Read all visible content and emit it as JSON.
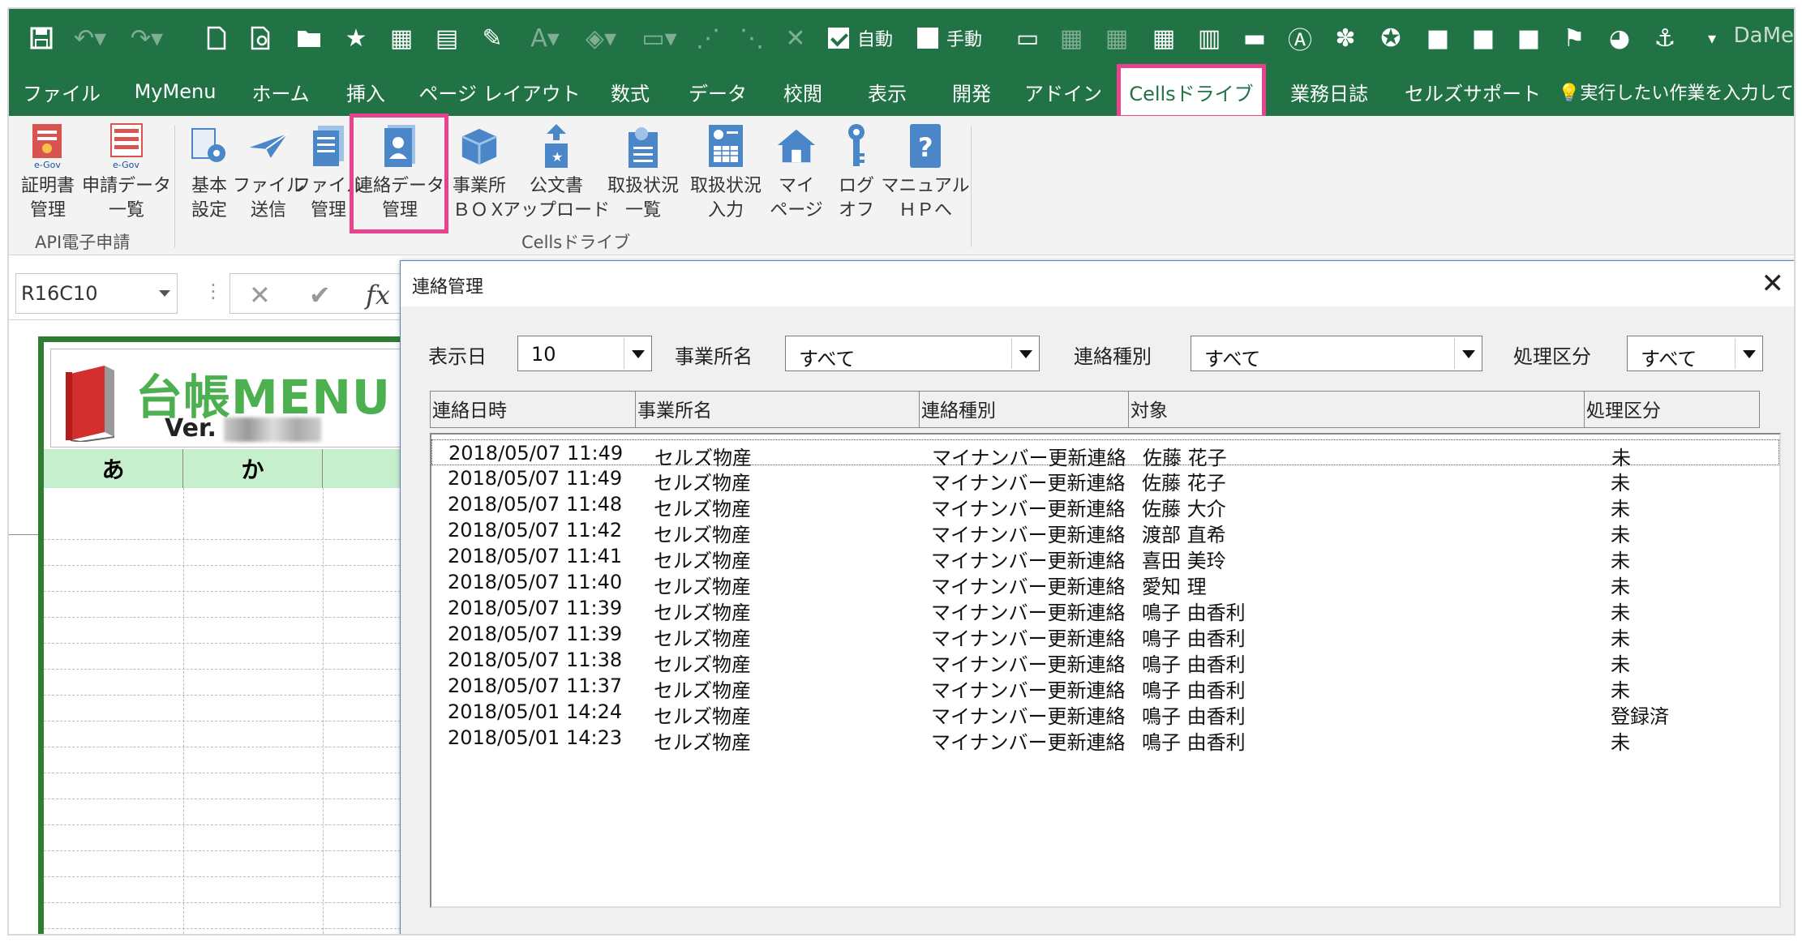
{
  "qat": {
    "save_icon": "save-icon",
    "auto_label": "自動",
    "manual_label": "手動",
    "user_label": "DaMe"
  },
  "tabs": {
    "file": "ファイル",
    "mymenu": "MyMenu",
    "home": "ホーム",
    "insert": "挿入",
    "pagelayout": "ページ レイアウト",
    "formulas": "数式",
    "data": "データ",
    "review": "校閲",
    "view": "表示",
    "developer": "開発",
    "addin": "アドイン",
    "cellsdrive": "Cellsドライブ",
    "gyomu": "業務日誌",
    "support": "セルズサポート",
    "tellme": "実行したい作業を入力してく"
  },
  "ribbon": {
    "cert": [
      "証明書",
      "管理"
    ],
    "applist": [
      "申請データ",
      "一覧"
    ],
    "group_api": "API電子申請",
    "basic": [
      "基本",
      "設定"
    ],
    "filesend": [
      "ファイル",
      "送信"
    ],
    "filemgmt": [
      "ファイル",
      "管理"
    ],
    "conn": [
      "連絡データ",
      "管理"
    ],
    "office": [
      "事業所",
      "ＢＯＸ"
    ],
    "upload": [
      "公文書",
      "アップロード"
    ],
    "statuslist": [
      "取扱状況",
      "一覧"
    ],
    "statusinput": [
      "取扱状況",
      "入力"
    ],
    "mypage": [
      "マイ",
      "ページ"
    ],
    "logoff": [
      "ログ",
      "オフ"
    ],
    "manual": [
      "マニュアル",
      "ＨＰへ"
    ],
    "group_cells": "Cellsドライブ"
  },
  "formula": {
    "namebox": "R16C10",
    "cancel": "✕",
    "enter": "✔",
    "fx": "fx"
  },
  "sheet": {
    "menu_title": "台帳MENU",
    "menu_ver": "Ver.",
    "kana": [
      "あ",
      "か"
    ]
  },
  "dialog": {
    "title": "連絡管理",
    "close": "✕",
    "filters": {
      "date_label": "表示日",
      "date_value": "10",
      "office_label": "事業所名",
      "office_value": "すべて",
      "type_label": "連絡種別",
      "type_value": "すべて",
      "proc_label": "処理区分",
      "proc_value": "すべて"
    },
    "columns": [
      "連絡日時",
      "事業所名",
      "連絡種別",
      "対象",
      "処理区分"
    ],
    "rows": [
      [
        "2018/05/07 11:49",
        "セルズ物産",
        "マイナンバー更新連絡",
        "佐藤 花子",
        "未"
      ],
      [
        "2018/05/07 11:49",
        "セルズ物産",
        "マイナンバー更新連絡",
        "佐藤 花子",
        "未"
      ],
      [
        "2018/05/07 11:48",
        "セルズ物産",
        "マイナンバー更新連絡",
        "佐藤 大介",
        "未"
      ],
      [
        "2018/05/07 11:42",
        "セルズ物産",
        "マイナンバー更新連絡",
        "渡部 直希",
        "未"
      ],
      [
        "2018/05/07 11:41",
        "セルズ物産",
        "マイナンバー更新連絡",
        "喜田 美玲",
        "未"
      ],
      [
        "2018/05/07 11:40",
        "セルズ物産",
        "マイナンバー更新連絡",
        "愛知 理",
        "未"
      ],
      [
        "2018/05/07 11:39",
        "セルズ物産",
        "マイナンバー更新連絡",
        "鳴子 由香利",
        "未"
      ],
      [
        "2018/05/07 11:39",
        "セルズ物産",
        "マイナンバー更新連絡",
        "鳴子 由香利",
        "未"
      ],
      [
        "2018/05/07 11:38",
        "セルズ物産",
        "マイナンバー更新連絡",
        "鳴子 由香利",
        "未"
      ],
      [
        "2018/05/07 11:37",
        "セルズ物産",
        "マイナンバー更新連絡",
        "鳴子 由香利",
        "未"
      ],
      [
        "2018/05/01 14:24",
        "セルズ物産",
        "マイナンバー更新連絡",
        "鳴子 由香利",
        "登録済"
      ],
      [
        "2018/05/01 14:23",
        "セルズ物産",
        "マイナンバー更新連絡",
        "鳴子 由香利",
        "未"
      ]
    ]
  },
  "colors": {
    "excel_green": "#217346",
    "highlight_pink": "#e8418e",
    "menu_green": "#4caf50"
  }
}
